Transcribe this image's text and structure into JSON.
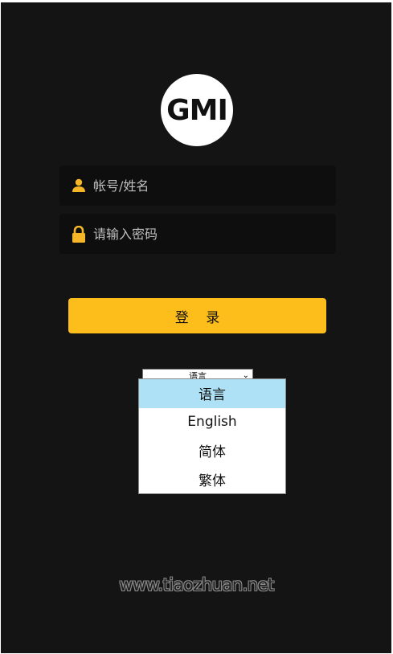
{
  "logo": {
    "text": "GMI"
  },
  "login_form": {
    "username_placeholder": "帐号/姓名",
    "password_placeholder": "请输入密码",
    "login_button": "登 录"
  },
  "language": {
    "selected": "语言",
    "options": [
      "语言",
      "English",
      "简体",
      "繁体"
    ]
  },
  "watermark": "www.tiaozhuan.net",
  "colors": {
    "background": "#141414",
    "accent": "#fdbe1b",
    "field": "#0e0e0e",
    "selected_option": "#afe1f6"
  }
}
